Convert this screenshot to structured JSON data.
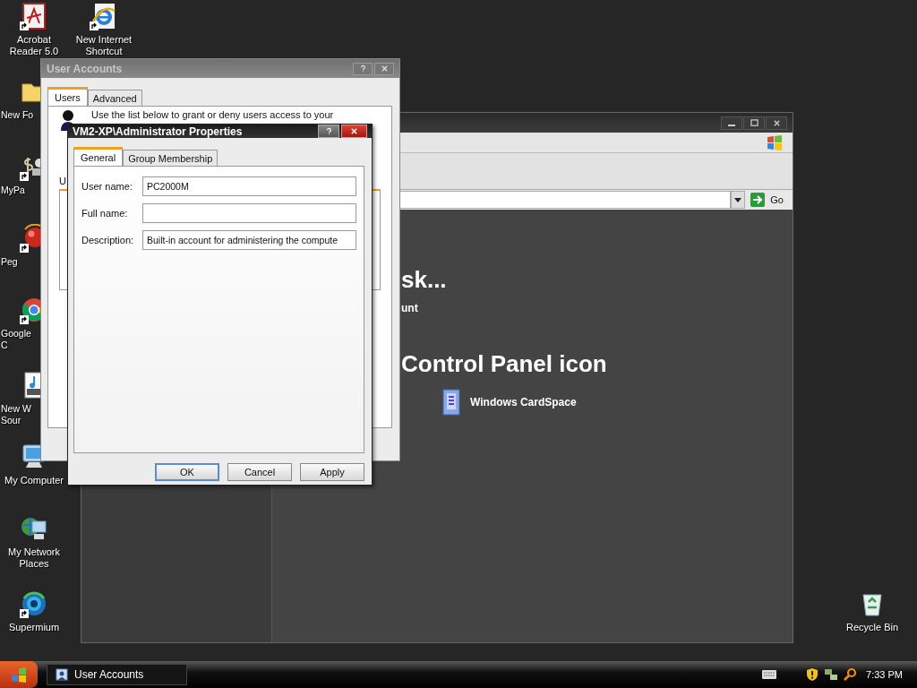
{
  "desktop_icons": [
    {
      "label": "Acrobat Reader 5.0",
      "kind": "acrobat",
      "shortcut": true
    },
    {
      "label": "New Internet Shortcut",
      "kind": "ie",
      "shortcut": true
    },
    {
      "label": "New Fo",
      "kind": "folder",
      "shortcut": false
    },
    {
      "label": "MyPa",
      "kind": "mypa",
      "shortcut": true
    },
    {
      "label": "Peg",
      "kind": "peg",
      "shortcut": true
    },
    {
      "label": "Google C",
      "kind": "chrome",
      "shortcut": true
    },
    {
      "label": "New W Sour",
      "kind": "wav",
      "shortcut": false
    },
    {
      "label": "My Computer",
      "kind": "computer",
      "shortcut": false
    },
    {
      "label": "My Network Places",
      "kind": "network",
      "shortcut": false
    },
    {
      "label": "Supermium",
      "kind": "supermium",
      "shortcut": true
    },
    {
      "label": "Recycle Bin",
      "kind": "recycle",
      "shortcut": false
    }
  ],
  "control_panel_window": {
    "go_button": "Go",
    "heading": "sk...",
    "task_link": "unt",
    "section_heading": "Control Panel icon",
    "items": [
      {
        "label": "Windows CardSpace"
      }
    ]
  },
  "user_accounts_window": {
    "title": "User Accounts",
    "tabs": [
      {
        "label": "Users",
        "selected": true
      },
      {
        "label": "Advanced",
        "selected": false
      }
    ],
    "intro": "Use the list below to grant or deny users access to your",
    "list_label": "U"
  },
  "properties_dialog": {
    "title": "VM2-XP\\Administrator Properties",
    "tabs": [
      {
        "label": "General",
        "selected": true
      },
      {
        "label": "Group Membership",
        "selected": false
      }
    ],
    "fields": [
      {
        "label": "User name:",
        "value": "PC2000M"
      },
      {
        "label": "Full name:"
      },
      {
        "label": "Description:",
        "value": "Built-in account for administering the compute"
      }
    ],
    "buttons": [
      {
        "label": "OK",
        "default": true
      },
      {
        "label": "Cancel",
        "default": false
      },
      {
        "label": "Apply",
        "default": false
      }
    ]
  },
  "taskbar": {
    "tasks": [
      {
        "label": "User Accounts",
        "selected": false
      }
    ],
    "clock": "7:33 PM"
  }
}
